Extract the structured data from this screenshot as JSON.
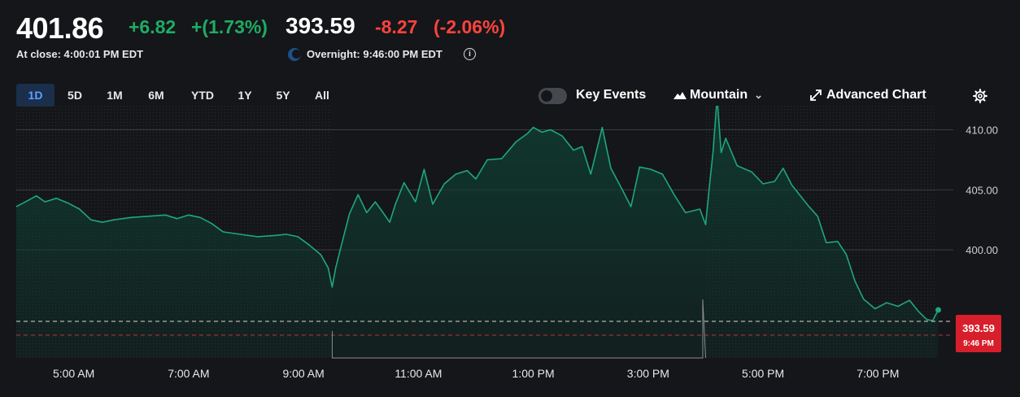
{
  "quote": {
    "close_price": "401.86",
    "close_change": "+6.82",
    "close_change_pct": "+(1.73%)",
    "close_label": "At close: 4:00:01 PM EDT",
    "overnight_price": "393.59",
    "overnight_change": "-8.27",
    "overnight_change_pct": "(-2.06%)",
    "overnight_label": "Overnight: 9:46:00 PM EDT",
    "info_icon": "i"
  },
  "ranges": [
    "1D",
    "5D",
    "1M",
    "6M",
    "YTD",
    "1Y",
    "5Y",
    "All"
  ],
  "active_range": "1D",
  "controls": {
    "key_events_label": "Key Events",
    "key_events_on": false,
    "chart_style_label": "Mountain",
    "chart_style_caret": "⌄",
    "advanced_chart_label": "Advanced Chart",
    "settings_icon": "gear-icon"
  },
  "colors": {
    "line": "#1ea878",
    "area": "#0f3b30",
    "up": "#1fab63",
    "down": "#ff433d",
    "active_tab_bg": "#1b2f4c",
    "active_tab_text": "#5aa0ff",
    "background": "#141619"
  },
  "chart_data": {
    "type": "area",
    "x_ticks": [
      "5:00 AM",
      "7:00 AM",
      "9:00 AM",
      "11:00 AM",
      "1:00 PM",
      "3:00 PM",
      "5:00 PM",
      "7:00 PM"
    ],
    "y_ticks": [
      "410.00",
      "405.00",
      "400.00"
    ],
    "ylim": [
      391,
      412
    ],
    "grid": true,
    "previous_close_marker": "393.59",
    "current_price_label": "393.59",
    "current_time_label": "9:46 PM",
    "series": [
      {
        "values": [
          [
            4.0,
            403.6
          ],
          [
            4.2,
            404.1
          ],
          [
            4.35,
            404.5
          ],
          [
            4.5,
            404.0
          ],
          [
            4.7,
            404.3
          ],
          [
            4.9,
            403.9
          ],
          [
            5.1,
            403.4
          ],
          [
            5.3,
            402.5
          ],
          [
            5.5,
            402.3
          ],
          [
            5.7,
            402.5
          ],
          [
            6.0,
            402.7
          ],
          [
            6.3,
            402.8
          ],
          [
            6.6,
            402.9
          ],
          [
            6.8,
            402.6
          ],
          [
            7.0,
            402.9
          ],
          [
            7.2,
            402.7
          ],
          [
            7.4,
            402.2
          ],
          [
            7.6,
            401.5
          ],
          [
            7.9,
            401.3
          ],
          [
            8.2,
            401.1
          ],
          [
            8.5,
            401.2
          ],
          [
            8.7,
            401.3
          ],
          [
            8.9,
            401.1
          ],
          [
            9.1,
            400.4
          ],
          [
            9.3,
            399.6
          ],
          [
            9.43,
            398.5
          ],
          [
            9.5,
            396.9
          ],
          [
            9.56,
            398.5
          ],
          [
            9.65,
            400.2
          ],
          [
            9.8,
            403.0
          ],
          [
            9.95,
            404.6
          ],
          [
            10.1,
            403.1
          ],
          [
            10.25,
            404.0
          ],
          [
            10.4,
            403.0
          ],
          [
            10.5,
            402.3
          ],
          [
            10.6,
            403.8
          ],
          [
            10.75,
            405.6
          ],
          [
            10.95,
            404.0
          ],
          [
            11.1,
            406.7
          ],
          [
            11.25,
            403.8
          ],
          [
            11.45,
            405.5
          ],
          [
            11.65,
            406.3
          ],
          [
            11.85,
            406.6
          ],
          [
            12.0,
            405.9
          ],
          [
            12.2,
            407.5
          ],
          [
            12.45,
            407.6
          ],
          [
            12.7,
            409.0
          ],
          [
            12.9,
            409.7
          ],
          [
            13.0,
            410.2
          ],
          [
            13.15,
            409.8
          ],
          [
            13.3,
            410.0
          ],
          [
            13.5,
            409.5
          ],
          [
            13.7,
            408.3
          ],
          [
            13.85,
            408.6
          ],
          [
            14.0,
            406.3
          ],
          [
            14.2,
            410.2
          ],
          [
            14.35,
            406.8
          ],
          [
            14.55,
            405.0
          ],
          [
            14.7,
            403.6
          ],
          [
            14.85,
            406.9
          ],
          [
            15.05,
            406.7
          ],
          [
            15.25,
            406.3
          ],
          [
            15.45,
            404.6
          ],
          [
            15.65,
            403.1
          ],
          [
            15.9,
            403.4
          ],
          [
            16.0,
            402.1
          ],
          [
            16.06,
            405.0
          ],
          [
            16.13,
            408.2
          ],
          [
            16.2,
            412.7
          ],
          [
            16.27,
            408.1
          ],
          [
            16.35,
            409.3
          ],
          [
            16.55,
            407.0
          ],
          [
            16.8,
            406.5
          ],
          [
            17.0,
            405.5
          ],
          [
            17.2,
            405.7
          ],
          [
            17.35,
            406.8
          ],
          [
            17.5,
            405.4
          ],
          [
            17.65,
            404.5
          ],
          [
            17.8,
            403.6
          ],
          [
            17.95,
            402.8
          ],
          [
            18.1,
            400.6
          ],
          [
            18.3,
            400.7
          ],
          [
            18.45,
            399.6
          ],
          [
            18.6,
            397.4
          ],
          [
            18.75,
            395.9
          ],
          [
            18.95,
            395.1
          ],
          [
            19.15,
            395.6
          ],
          [
            19.35,
            395.3
          ],
          [
            19.55,
            395.8
          ],
          [
            19.7,
            394.9
          ],
          [
            19.85,
            394.2
          ],
          [
            19.95,
            394.1
          ],
          [
            20.05,
            395.0
          ]
        ]
      }
    ]
  }
}
